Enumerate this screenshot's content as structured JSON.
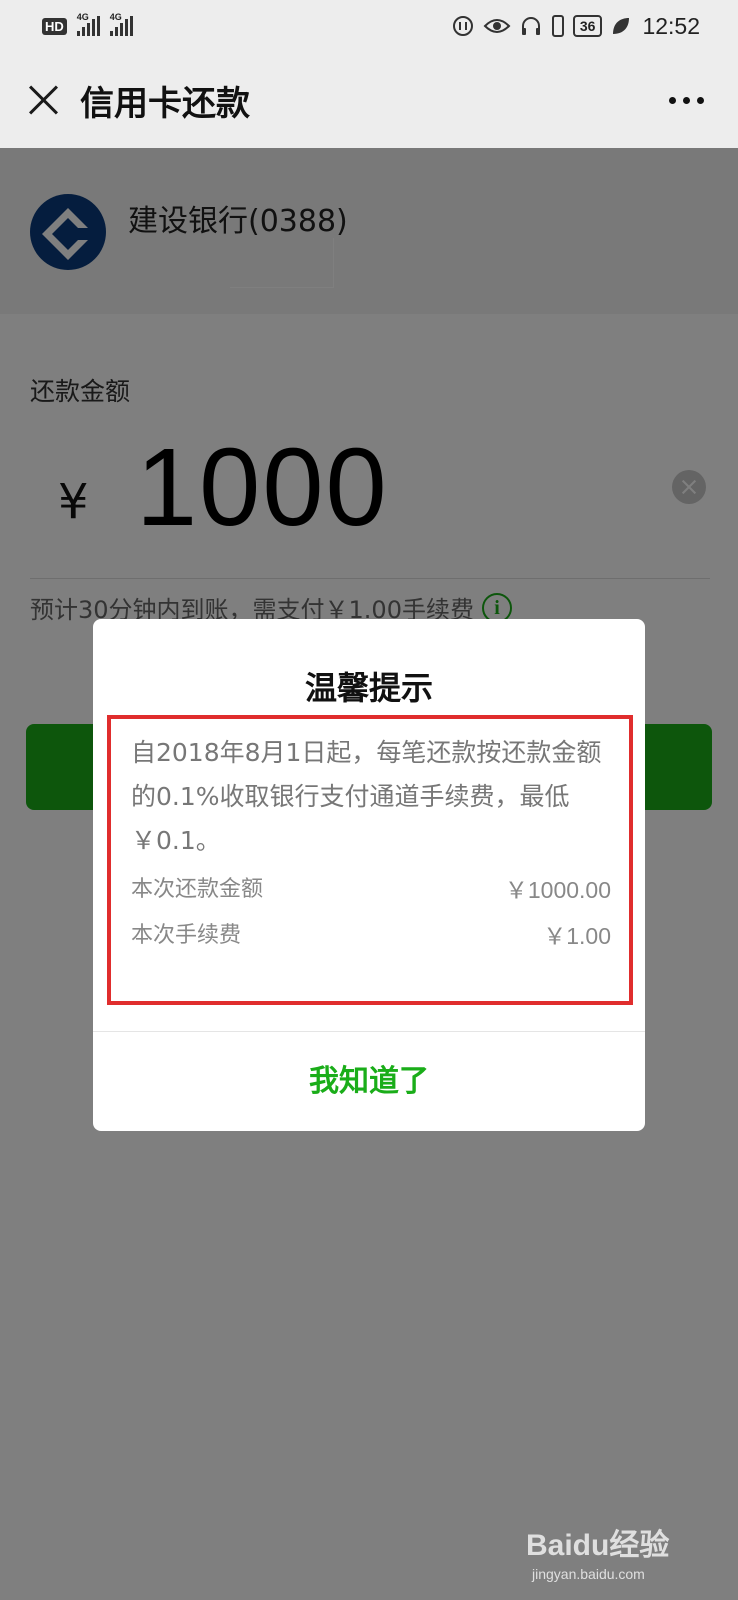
{
  "status_bar": {
    "hd_label": "HD",
    "signal1_label": "4G",
    "signal2_label": "4G",
    "battery": "36",
    "time": "12:52"
  },
  "nav": {
    "title": "信用卡还款"
  },
  "card": {
    "bank_name": "建设银行(0388)"
  },
  "form": {
    "amount_label": "还款金额",
    "currency_symbol": "¥",
    "amount": "1000",
    "fee_note": "预计30分钟内到账，需支付￥1.00手续费",
    "info_glyph": "i"
  },
  "dialog": {
    "title": "温馨提示",
    "message": "自2018年8月1日起，每笔还款按还款金额的0.1%收取银行支付通道手续费，最低￥0.1。",
    "rows": [
      {
        "label": "本次还款金额",
        "value": "￥1000.00"
      },
      {
        "label": "本次手续费",
        "value": "￥1.00"
      }
    ],
    "button_label": "我知道了"
  },
  "watermark": {
    "brand": "Baidu经验",
    "url": "jingyan.baidu.com"
  },
  "colors": {
    "accent_green": "#1aad19",
    "highlight_red": "#e02d2d",
    "bank_blue": "#0b3b7c"
  }
}
